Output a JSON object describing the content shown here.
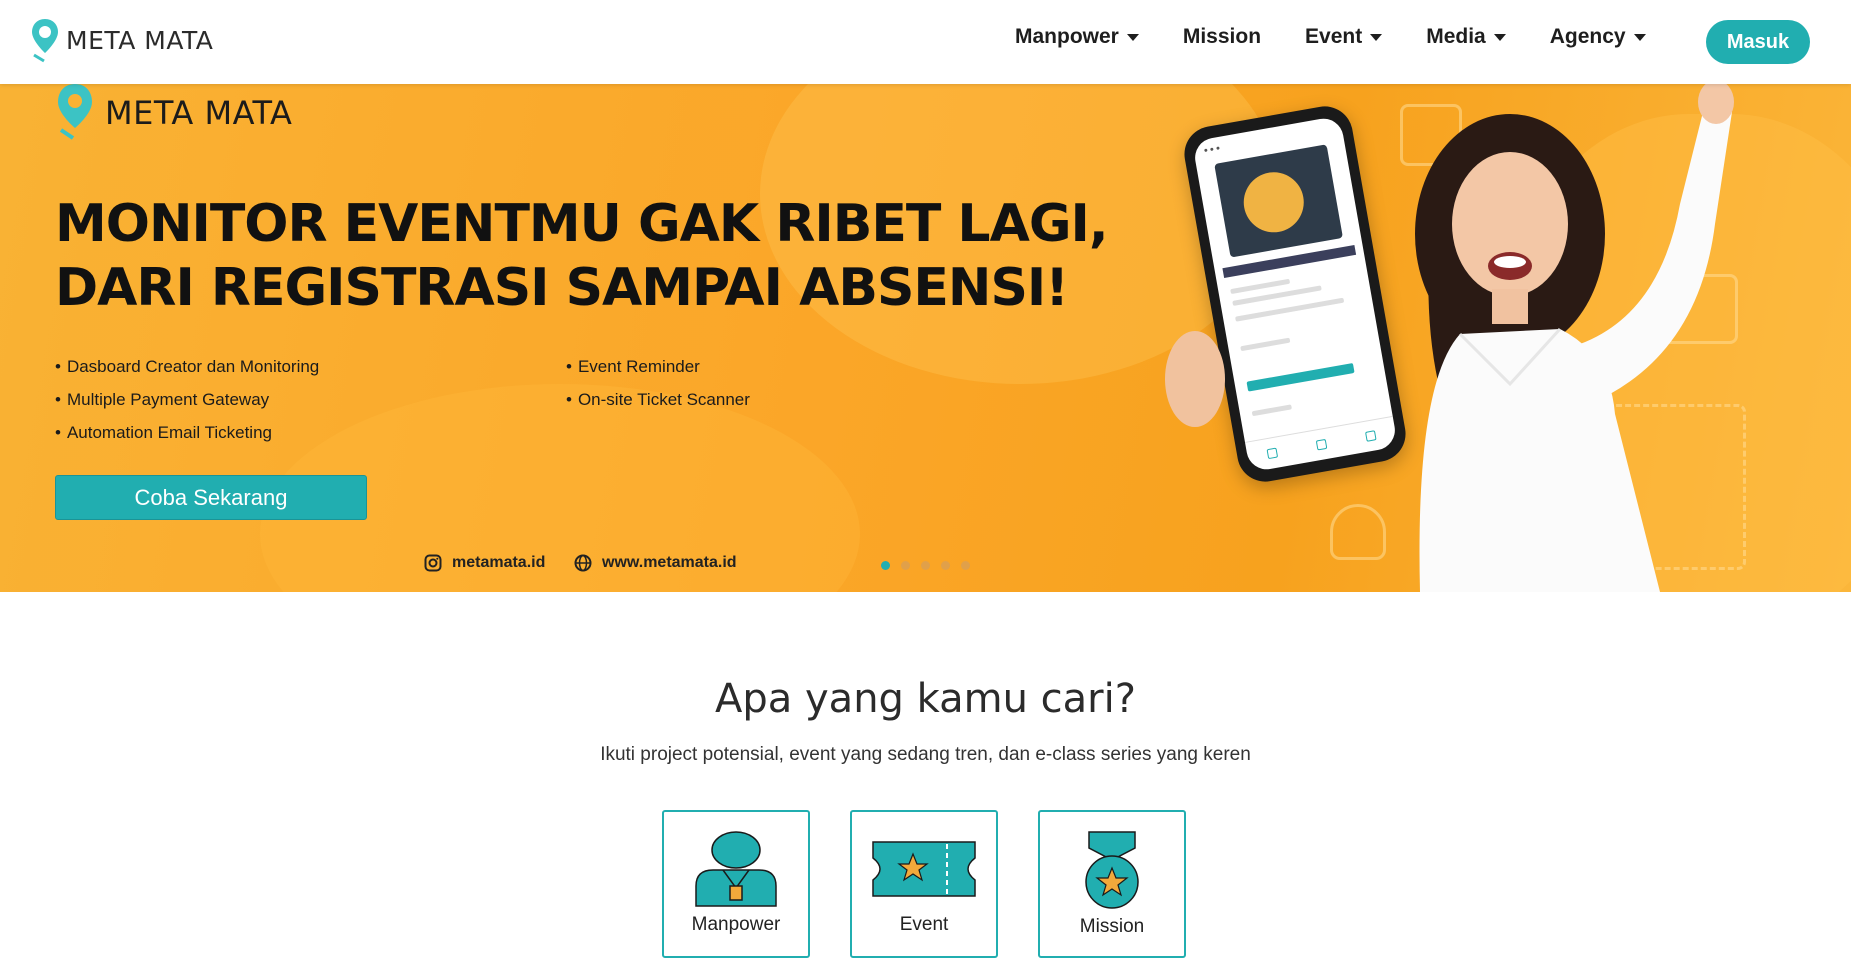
{
  "navbar": {
    "brand": "META MATA",
    "menu": [
      {
        "label": "Manpower",
        "dropdown": true
      },
      {
        "label": "Mission",
        "dropdown": false
      },
      {
        "label": "Event",
        "dropdown": true
      },
      {
        "label": "Media",
        "dropdown": true
      },
      {
        "label": "Agency",
        "dropdown": true
      }
    ],
    "login_label": "Masuk"
  },
  "hero": {
    "brand": "META MATA",
    "headline_line1": "MONITOR EVENTMU GAK RIBET LAGI,",
    "headline_line2": "DARI REGISTRASI SAMPAI ABSENSI!",
    "features_left": [
      "Dasboard Creator dan Monitoring",
      "Multiple Payment Gateway",
      "Automation Email Ticketing"
    ],
    "features_right": [
      "Event Reminder",
      "On-site Ticket Scanner"
    ],
    "cta_label": "Coba Sekarang",
    "instagram": "metamata.id",
    "website": "www.metamata.id",
    "slides_total": 5,
    "active_slide": 1
  },
  "section": {
    "title": "Apa yang kamu cari?",
    "subtitle": "Ikuti project potensial, event yang sedang tren, dan e-class series yang keren",
    "cards": [
      {
        "label": "Manpower",
        "icon": "person-icon"
      },
      {
        "label": "Event",
        "icon": "ticket-icon"
      },
      {
        "label": "Mission",
        "icon": "medal-icon"
      }
    ]
  },
  "colors": {
    "accent": "#21aeb0",
    "hero_bg": "#f9a82a",
    "star": "#f2a93b"
  }
}
